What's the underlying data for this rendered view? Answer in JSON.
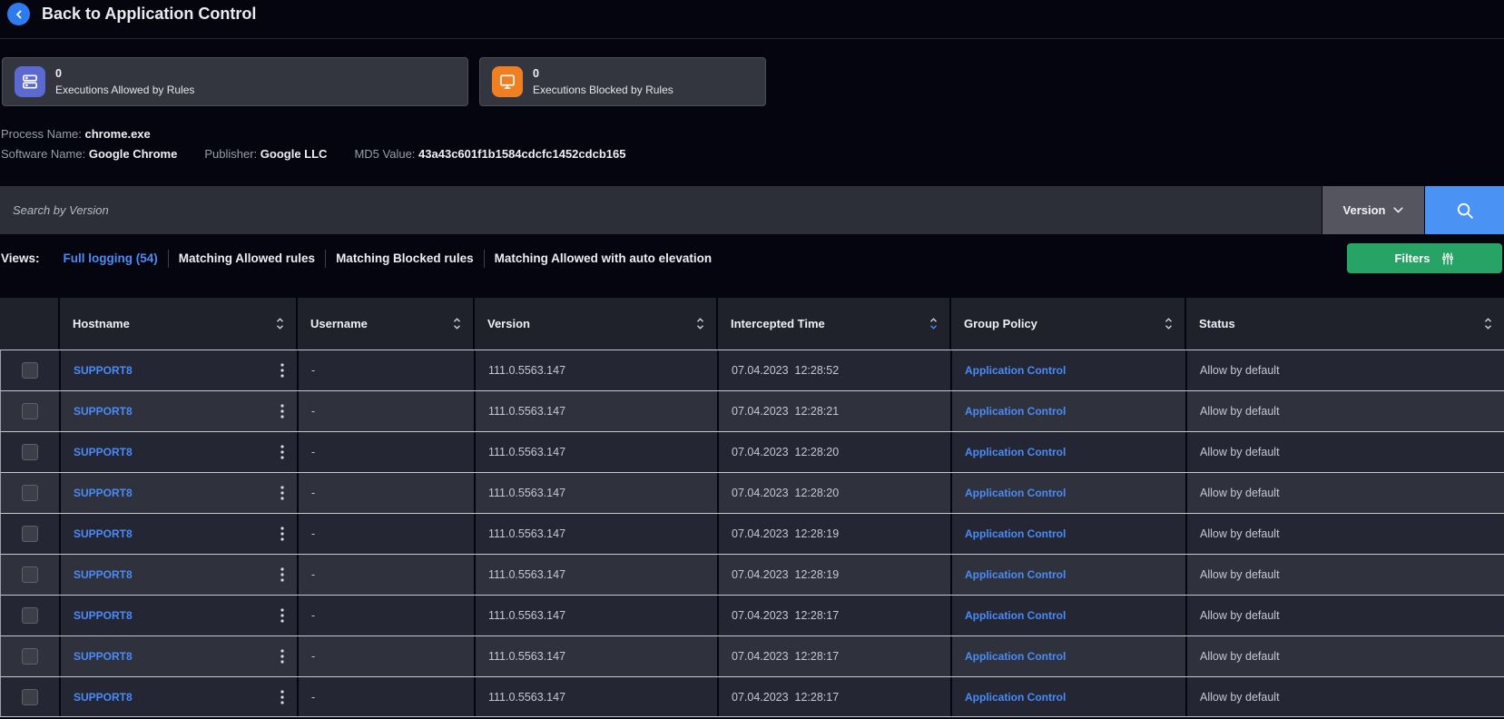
{
  "header": {
    "title": "Back to Application Control"
  },
  "stats": [
    {
      "value": "0",
      "label": "Executions Allowed by Rules",
      "icon": "server-stack-icon",
      "color": "#5b6ad0"
    },
    {
      "value": "0",
      "label": "Executions Blocked by Rules",
      "icon": "monitor-icon",
      "color": "#f07f22"
    }
  ],
  "process_info": {
    "process_name": {
      "label": "Process Name:",
      "value": "chrome.exe"
    },
    "software_name": {
      "label": "Software Name:",
      "value": "Google Chrome"
    },
    "publisher": {
      "label": "Publisher:",
      "value": "Google LLC"
    },
    "md5": {
      "label": "MD5 Value:",
      "value": "43a43c601f1b1584cdcfc1452cdcb165"
    }
  },
  "search": {
    "placeholder": "Search by Version",
    "field_selector": "Version"
  },
  "views": {
    "label": "Views:",
    "tabs": [
      {
        "label": "Full logging (54)",
        "active": true
      },
      {
        "label": "Matching Allowed rules",
        "active": false
      },
      {
        "label": "Matching Blocked rules",
        "active": false
      },
      {
        "label": "Matching Allowed with auto elevation",
        "active": false
      }
    ]
  },
  "filters_button": {
    "label": "Filters"
  },
  "accents": {
    "link_blue": "#4a8cf7",
    "search_button_blue": "#4b92f5",
    "filters_green": "#27a366",
    "back_button_blue": "#2e7bf0"
  },
  "table": {
    "columns": [
      "Hostname",
      "Username",
      "Version",
      "Intercepted Time",
      "Group Policy",
      "Status"
    ],
    "sort": {
      "column": "Intercepted Time",
      "direction": "desc"
    },
    "rows": [
      {
        "hostname": "SUPPORT8",
        "username": "-",
        "version": "111.0.5563.147",
        "intercepted_time": "07.04.2023  12:28:52",
        "group_policy": "Application Control",
        "status": "Allow by default"
      },
      {
        "hostname": "SUPPORT8",
        "username": "-",
        "version": "111.0.5563.147",
        "intercepted_time": "07.04.2023  12:28:21",
        "group_policy": "Application Control",
        "status": "Allow by default"
      },
      {
        "hostname": "SUPPORT8",
        "username": "-",
        "version": "111.0.5563.147",
        "intercepted_time": "07.04.2023  12:28:20",
        "group_policy": "Application Control",
        "status": "Allow by default"
      },
      {
        "hostname": "SUPPORT8",
        "username": "-",
        "version": "111.0.5563.147",
        "intercepted_time": "07.04.2023  12:28:20",
        "group_policy": "Application Control",
        "status": "Allow by default"
      },
      {
        "hostname": "SUPPORT8",
        "username": "-",
        "version": "111.0.5563.147",
        "intercepted_time": "07.04.2023  12:28:19",
        "group_policy": "Application Control",
        "status": "Allow by default"
      },
      {
        "hostname": "SUPPORT8",
        "username": "-",
        "version": "111.0.5563.147",
        "intercepted_time": "07.04.2023  12:28:19",
        "group_policy": "Application Control",
        "status": "Allow by default"
      },
      {
        "hostname": "SUPPORT8",
        "username": "-",
        "version": "111.0.5563.147",
        "intercepted_time": "07.04.2023  12:28:17",
        "group_policy": "Application Control",
        "status": "Allow by default"
      },
      {
        "hostname": "SUPPORT8",
        "username": "-",
        "version": "111.0.5563.147",
        "intercepted_time": "07.04.2023  12:28:17",
        "group_policy": "Application Control",
        "status": "Allow by default"
      },
      {
        "hostname": "SUPPORT8",
        "username": "-",
        "version": "111.0.5563.147",
        "intercepted_time": "07.04.2023  12:28:17",
        "group_policy": "Application Control",
        "status": "Allow by default"
      }
    ]
  }
}
